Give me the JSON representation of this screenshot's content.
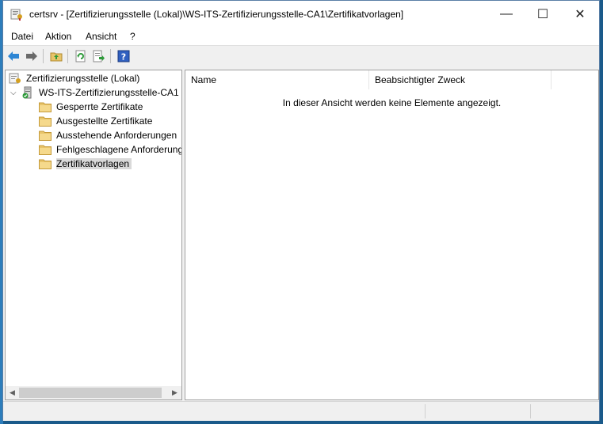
{
  "window": {
    "title": "certsrv - [Zertifizierungsstelle (Lokal)\\WS-ITS-Zertifizierungsstelle-CA1\\Zertifikatvorlagen]",
    "minimize_glyph": "—",
    "maximize_glyph": "☐",
    "close_glyph": "✕"
  },
  "menu": {
    "items": [
      "Datei",
      "Aktion",
      "Ansicht",
      "?"
    ]
  },
  "toolbar": {
    "buttons": [
      "back-arrow-icon",
      "forward-arrow-icon",
      "up-folder-icon",
      "refresh-icon",
      "export-list-icon",
      "help-icon"
    ]
  },
  "tree": {
    "root": "Zertifizierungsstelle (Lokal)",
    "ca": "WS-ITS-Zertifizierungsstelle-CA1",
    "children": [
      "Gesperrte Zertifikate",
      "Ausgestellte Zertifikate",
      "Ausstehende Anforderungen",
      "Fehlgeschlagene Anforderungen",
      "Zertifikatvorlagen"
    ],
    "selected_index": 4
  },
  "list": {
    "columns": [
      "Name",
      "Beabsichtigter Zweck"
    ],
    "empty_message": "In dieser Ansicht werden keine Elemente angezeigt."
  },
  "colors": {
    "folder": "#e8c46a",
    "selection": "#d9d9d9",
    "back_arrow": "#2e86d4",
    "forward_arrow": "#6a6a6a"
  }
}
